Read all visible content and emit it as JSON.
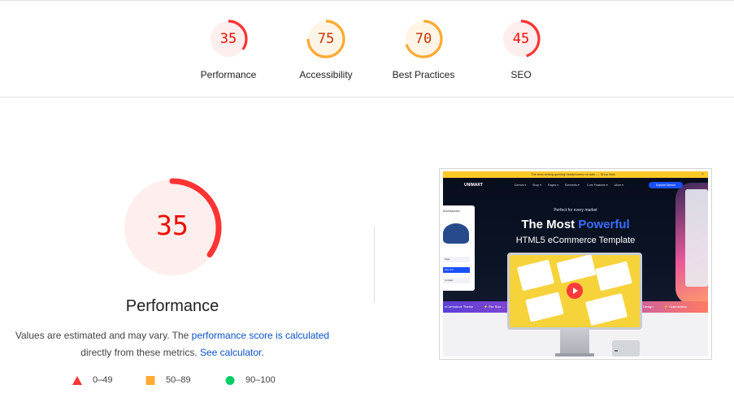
{
  "scores": [
    {
      "label": "Performance",
      "score": "35",
      "value": 0.35,
      "color": "#ff3333",
      "fill": "#ffeeee",
      "text_color": "#eb0f00"
    },
    {
      "label": "Accessibility",
      "score": "75",
      "value": 0.75,
      "color": "#ffaa33",
      "fill": "#fff5e6",
      "text_color": "#c33300"
    },
    {
      "label": "Best Practices",
      "score": "70",
      "value": 0.7,
      "color": "#ffaa33",
      "fill": "#fff5e6",
      "text_color": "#c33300"
    },
    {
      "label": "SEO",
      "score": "45",
      "value": 0.45,
      "color": "#ff3333",
      "fill": "#ffeeee",
      "text_color": "#eb0f00"
    }
  ],
  "main": {
    "score": "35",
    "value": 0.35,
    "title": "Performance",
    "desc_prefix": "Values are estimated and may vary. The ",
    "desc_link": "performance score is calculated",
    "desc_middle": "directly from these metrics. ",
    "calc_link": "See calculator",
    "desc_suffix": "."
  },
  "legend": [
    {
      "icon": "triangle-icon",
      "range": "0–49",
      "color": "#ff3333"
    },
    {
      "icon": "square-icon",
      "range": "50–89",
      "color": "#ffaa33"
    },
    {
      "icon": "circle-icon",
      "range": "90–100",
      "color": "#00cc66"
    }
  ],
  "screenshot": {
    "promo": "The best selling gaming headphones on sale — Shop Now",
    "logo": "UNIMART",
    "nav": [
      "Demos ▾",
      "Shop ▾",
      "Pages ▾",
      "Elements ▾",
      "Core Features ▾",
      "More ▾"
    ],
    "cta": "Explore Demos",
    "tagline": "Perfect for every market",
    "headline_a": "The Most ",
    "headline_b": "Powerful",
    "subheadline": "HTML5 eCommerce Template",
    "left_card_title": "Accessories",
    "left_rows": [
      "Tags",
      "Item 1/2",
      "Contact"
    ],
    "strip_items": [
      "eCommerce Theme",
      "⚡ File Size ...",
      "Design",
      "⚡ Optimization"
    ]
  }
}
